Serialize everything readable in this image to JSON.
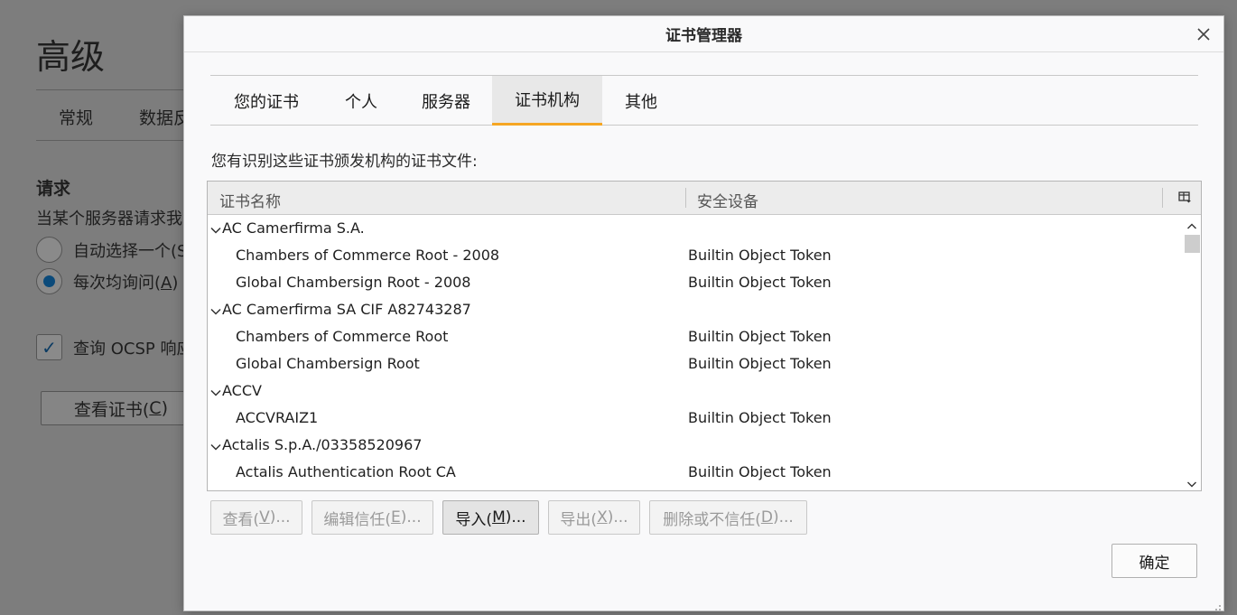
{
  "background": {
    "title": "高级",
    "tabs": [
      "常规",
      "数据反"
    ],
    "section_title": "请求",
    "section_desc": "当某个服务器请求我",
    "radio_auto": "自动选择一个(S",
    "radio_ask_text": "每次均询问(",
    "radio_ask_key": "A",
    "radio_ask_end": ")",
    "ocsp_label": "查询 OCSP 响应",
    "view_certs_text": "查看证书(",
    "view_certs_key": "C",
    "view_certs_end": ")"
  },
  "dialog": {
    "title": "证书管理器",
    "tabs": [
      {
        "label": "您的证书"
      },
      {
        "label": "个人"
      },
      {
        "label": "服务器"
      },
      {
        "label": "证书机构"
      },
      {
        "label": "其他"
      }
    ],
    "description": "您有识别这些证书颁发机构的证书文件:",
    "columns": {
      "name": "证书名称",
      "device": "安全设备"
    },
    "rows": [
      {
        "type": "group",
        "name": "AC Camerfirma S.A."
      },
      {
        "type": "cert",
        "name": "Chambers of Commerce Root - 2008",
        "device": "Builtin Object Token"
      },
      {
        "type": "cert",
        "name": "Global Chambersign Root - 2008",
        "device": "Builtin Object Token"
      },
      {
        "type": "group",
        "name": "AC Camerfirma SA CIF A82743287"
      },
      {
        "type": "cert",
        "name": "Chambers of Commerce Root",
        "device": "Builtin Object Token"
      },
      {
        "type": "cert",
        "name": "Global Chambersign Root",
        "device": "Builtin Object Token"
      },
      {
        "type": "group",
        "name": "ACCV"
      },
      {
        "type": "cert",
        "name": "ACCVRAIZ1",
        "device": "Builtin Object Token"
      },
      {
        "type": "group",
        "name": "Actalis S.p.A./03358520967"
      },
      {
        "type": "cert",
        "name": "Actalis Authentication Root CA",
        "device": "Builtin Object Token"
      }
    ],
    "buttons": {
      "view": {
        "text": "查看(",
        "key": "V",
        "end": ")..."
      },
      "edit": {
        "text": "编辑信任(",
        "key": "E",
        "end": ")..."
      },
      "import": {
        "text": "导入(",
        "key": "M",
        "end": ")..."
      },
      "export": {
        "text": "导出(",
        "key": "X",
        "end": ")..."
      },
      "delete": {
        "text": "删除或不信任(",
        "key": "D",
        "end": ")..."
      }
    },
    "ok_label": "确定"
  },
  "colors": {
    "tab_accent": "#f5a623",
    "overlay": "#7d7d7d"
  }
}
